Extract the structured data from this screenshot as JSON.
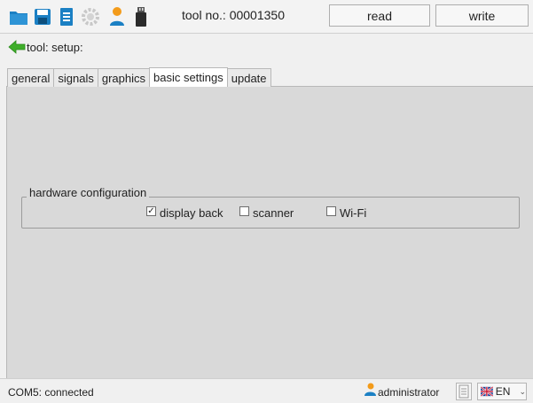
{
  "toolbar": {
    "icons": [
      "folder-open-icon",
      "save-icon",
      "list-icon",
      "gear-icon",
      "user-icon",
      "usb-drive-icon"
    ],
    "tool_label": "tool no.: 00001350",
    "read_label": "read",
    "write_label": "write"
  },
  "breadcrumb": {
    "label": "tool: setup:"
  },
  "tabs": [
    "general",
    "signals",
    "graphics",
    "basic settings",
    "update"
  ],
  "active_tab": "basic settings",
  "hardware_config": {
    "title": "hardware configuration",
    "options": [
      {
        "label": "display back",
        "checked": true
      },
      {
        "label": "scanner",
        "checked": false
      },
      {
        "label": "Wi-Fi",
        "checked": false
      }
    ]
  },
  "status": {
    "connection": "COM5: connected",
    "user": "administrator",
    "language": "EN"
  },
  "colors": {
    "panel_bg": "#d9d9d9",
    "back_arrow": "#3fae2a",
    "folder": "#1b80c4"
  }
}
